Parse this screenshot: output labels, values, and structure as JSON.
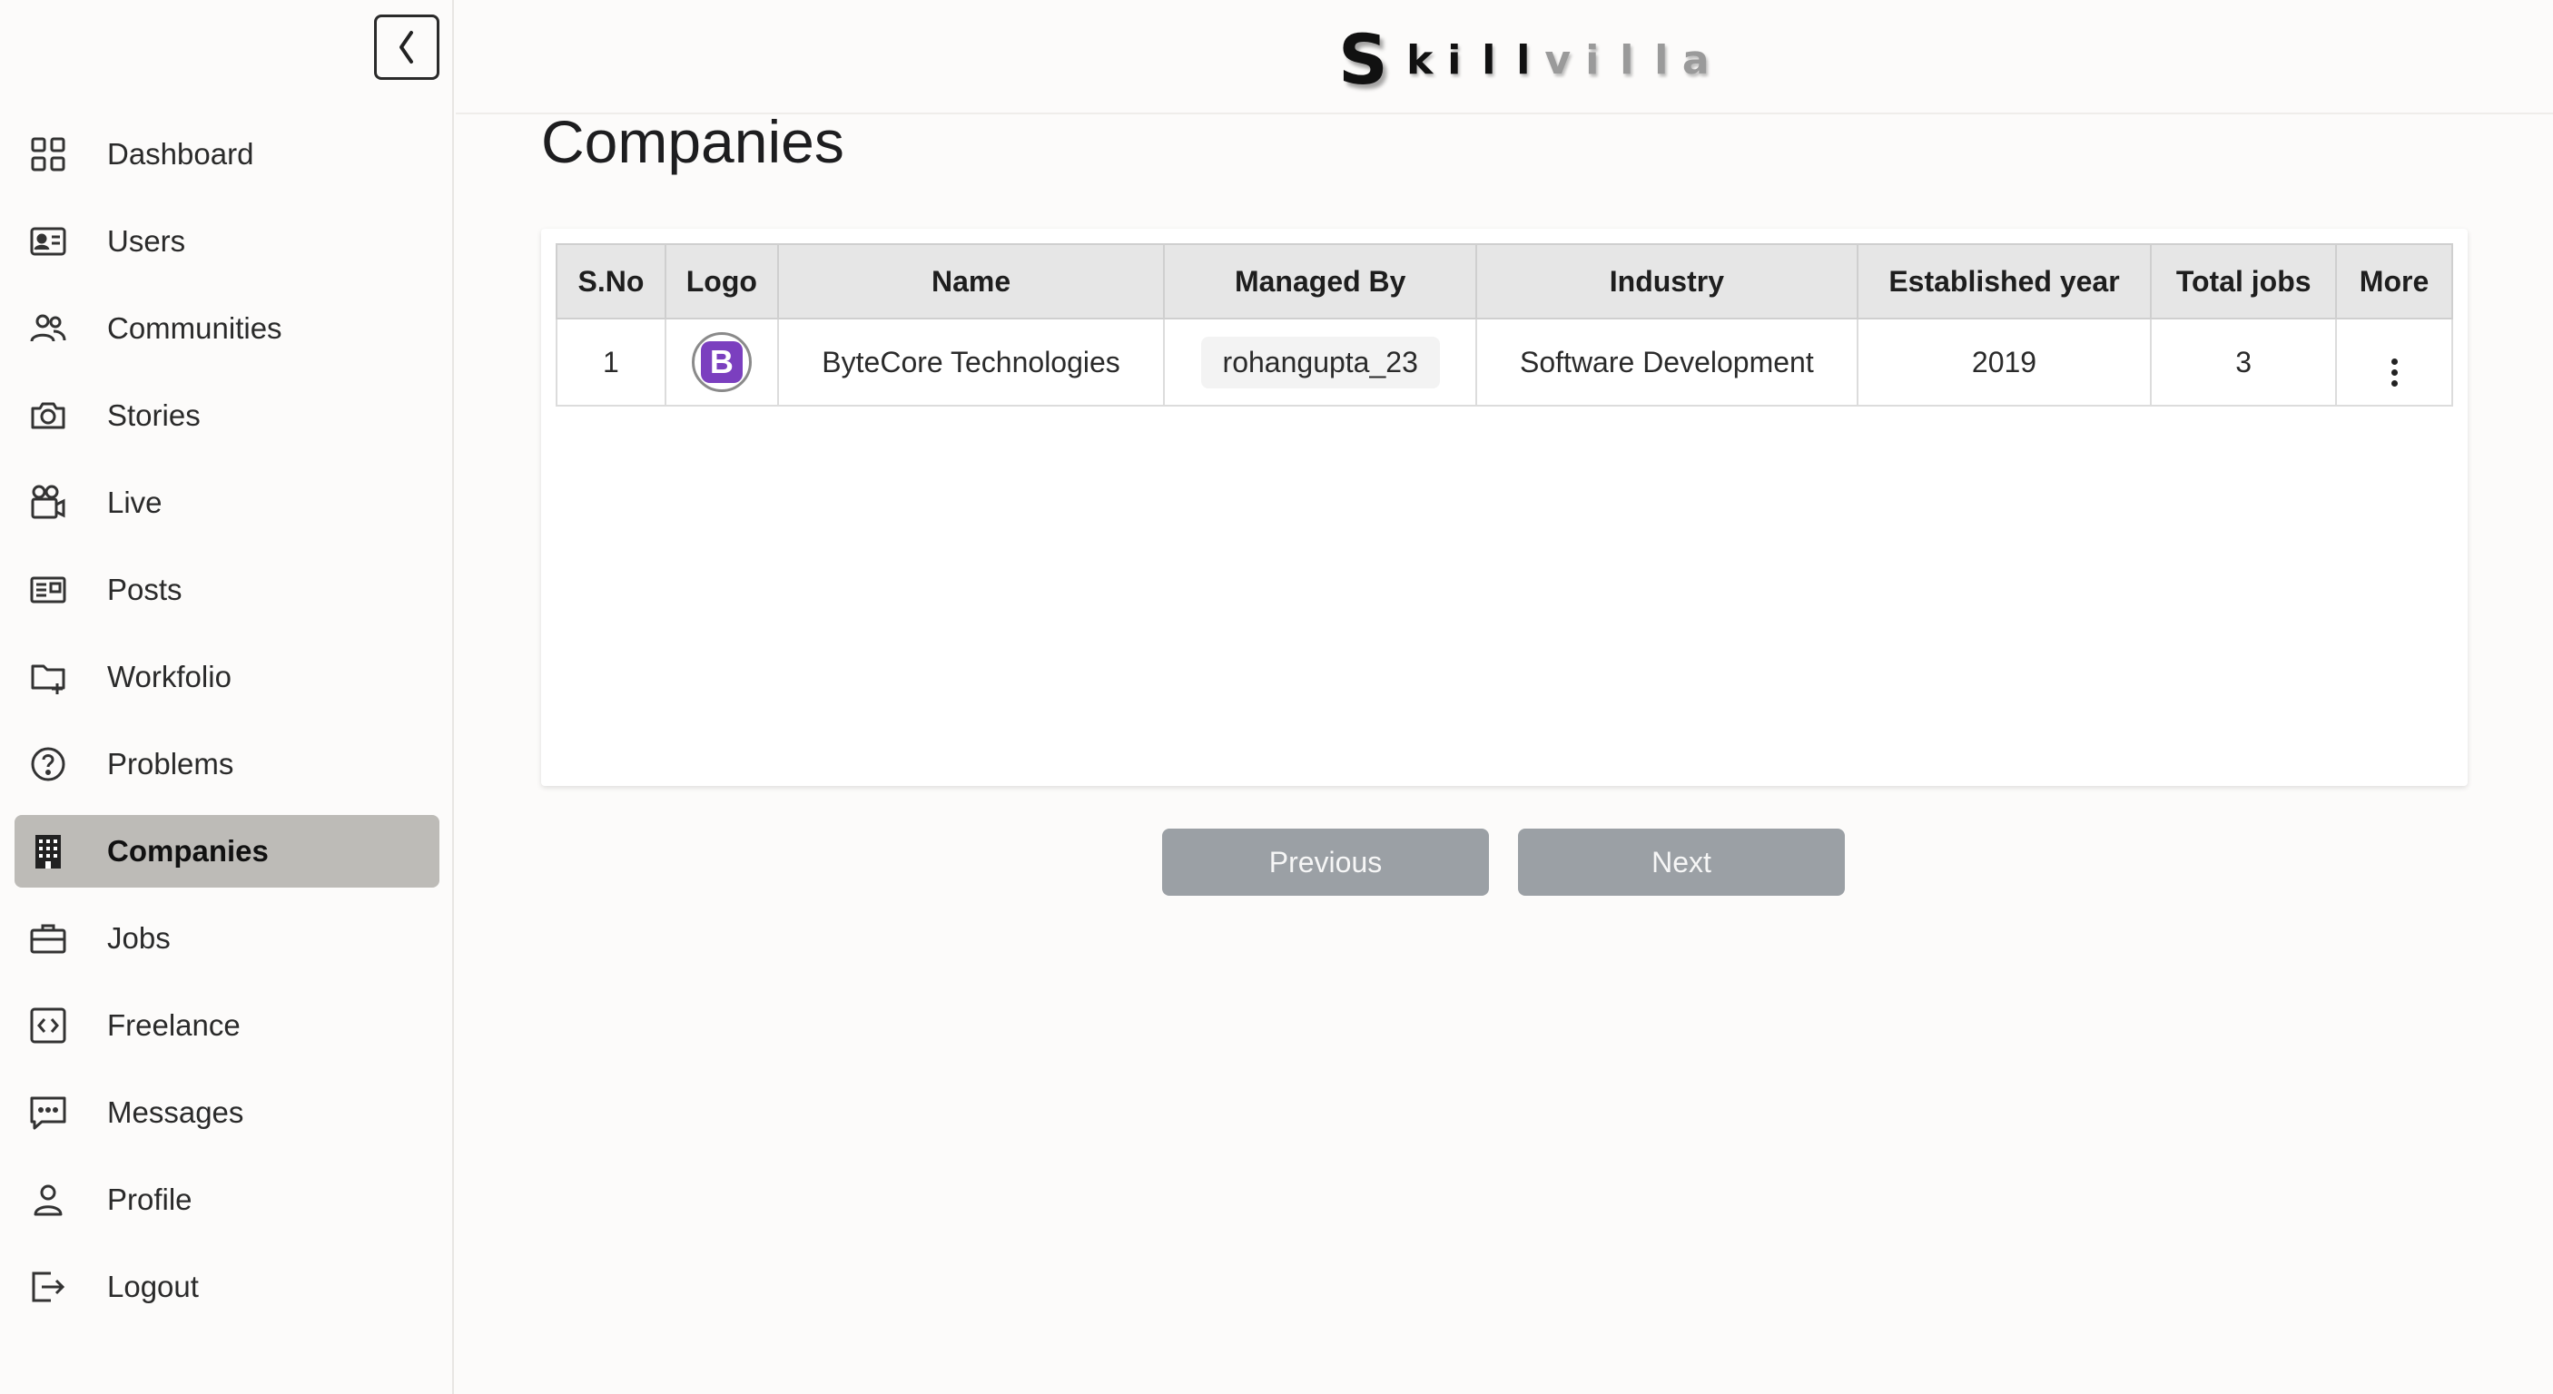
{
  "brand": {
    "first": "S",
    "rest_dark": [
      "k",
      "i",
      "l",
      "l"
    ],
    "rest_light": [
      "v",
      "i",
      "l",
      "l",
      "a"
    ]
  },
  "sidebar": {
    "items": [
      {
        "label": "Dashboard",
        "icon": "dashboard-icon"
      },
      {
        "label": "Users",
        "icon": "users-icon"
      },
      {
        "label": "Communities",
        "icon": "communities-icon"
      },
      {
        "label": "Stories",
        "icon": "camera-icon"
      },
      {
        "label": "Live",
        "icon": "video-camera-icon"
      },
      {
        "label": "Posts",
        "icon": "posts-icon"
      },
      {
        "label": "Workfolio",
        "icon": "folder-plus-icon"
      },
      {
        "label": "Problems",
        "icon": "question-icon"
      },
      {
        "label": "Companies",
        "icon": "building-icon",
        "active": true
      },
      {
        "label": "Jobs",
        "icon": "briefcase-icon"
      },
      {
        "label": "Freelance",
        "icon": "code-icon"
      },
      {
        "label": "Messages",
        "icon": "message-icon"
      },
      {
        "label": "Profile",
        "icon": "person-icon"
      },
      {
        "label": "Logout",
        "icon": "logout-icon"
      }
    ]
  },
  "page": {
    "title": "Companies"
  },
  "table": {
    "headers": [
      "S.No",
      "Logo",
      "Name",
      "Managed By",
      "Industry",
      "Established year",
      "Total jobs",
      "More"
    ],
    "rows": [
      {
        "sno": "1",
        "logo_letter": "B",
        "name": "ByteCore Technologies",
        "managed_by": "rohangupta_23",
        "industry": "Software Development",
        "established": "2019",
        "total_jobs": "3"
      }
    ]
  },
  "pagination": {
    "previous": "Previous",
    "next": "Next"
  },
  "colors": {
    "active_nav_bg": "#bdbbb7",
    "logo_badge": "#7b3fbf",
    "pager_button": "#9ba0a5"
  }
}
